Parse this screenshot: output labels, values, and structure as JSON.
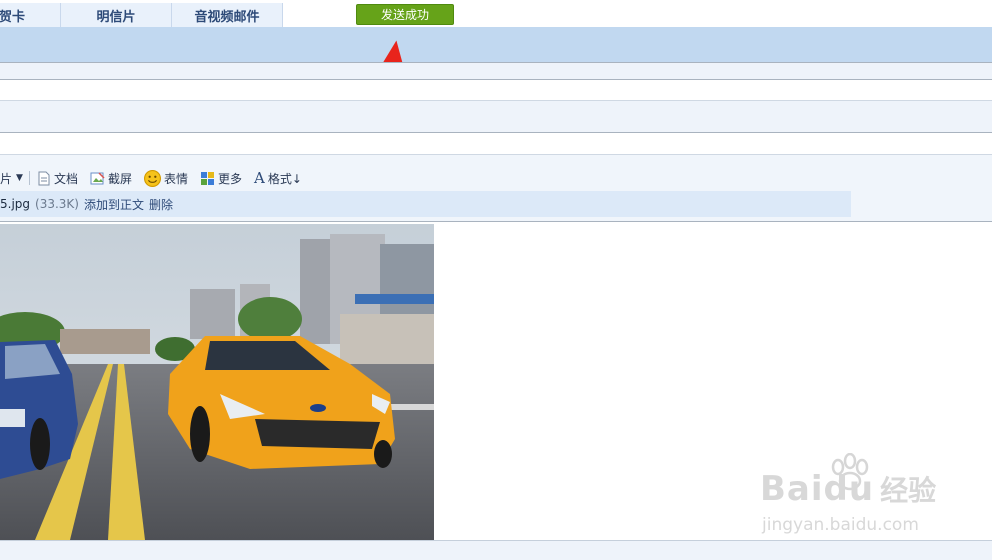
{
  "tabs": [
    {
      "label": "贺卡"
    },
    {
      "label": "明信片"
    },
    {
      "label": "音视频邮件"
    }
  ],
  "status": {
    "text": "发送成功",
    "color": "#66a319"
  },
  "toolbar": {
    "items": [
      {
        "label": "片",
        "icon": "image-icon"
      },
      {
        "label": "文档",
        "icon": "document-icon"
      },
      {
        "label": "截屏",
        "icon": "screenshot-icon"
      },
      {
        "label": "表情",
        "icon": "smiley-icon"
      },
      {
        "label": "更多",
        "icon": "more-grid-icon"
      },
      {
        "label": "格式↓",
        "icon": "format-a-icon"
      }
    ]
  },
  "attachment": {
    "filename": "5.jpg",
    "size": "(33.3K)",
    "add_to_body": "添加到正文",
    "delete": "删除"
  },
  "watermark": {
    "logo": "Baidu",
    "brand_cn": "经验",
    "url": "jingyan.baidu.com"
  }
}
